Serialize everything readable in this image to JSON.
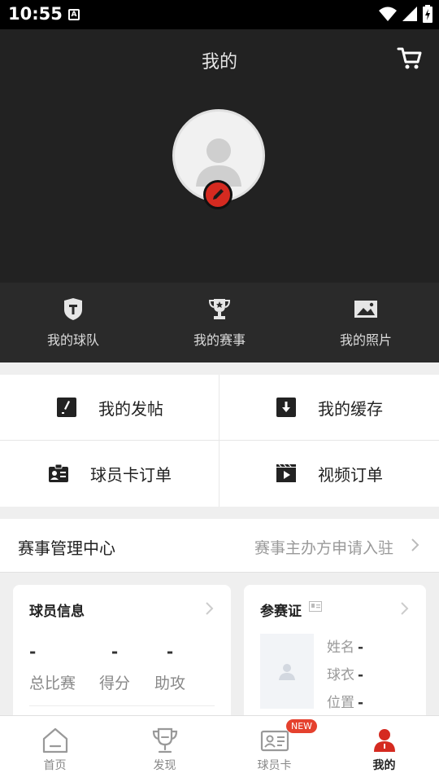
{
  "status": {
    "time": "10:55",
    "a_icon": "A"
  },
  "header": {
    "title": "我的"
  },
  "quicknav": [
    {
      "label": "我的球队",
      "icon": "team-shield-icon"
    },
    {
      "label": "我的赛事",
      "icon": "trophy-icon"
    },
    {
      "label": "我的照片",
      "icon": "photo-icon"
    }
  ],
  "grid": {
    "posts": "我的发帖",
    "cache": "我的缓存",
    "card_orders": "球员卡订单",
    "video_orders": "视频订单"
  },
  "management": {
    "title": "赛事管理中心",
    "link": "赛事主办方申请入驻"
  },
  "player_info": {
    "title": "球员信息",
    "stats": [
      {
        "value": "-",
        "label": "总比赛"
      },
      {
        "value": "-",
        "label": "得分"
      },
      {
        "value": "-",
        "label": "助攻"
      }
    ]
  },
  "credential": {
    "title": "参赛证",
    "name_label": "姓名",
    "name_value": "-",
    "jersey_label": "球衣",
    "jersey_value": "-",
    "position_label": "位置",
    "position_value": "-"
  },
  "tabbar": [
    {
      "label": "首页",
      "icon": "home-icon"
    },
    {
      "label": "发现",
      "icon": "trophy-icon"
    },
    {
      "label": "球员卡",
      "icon": "id-card-icon",
      "badge": "NEW"
    },
    {
      "label": "我的",
      "icon": "person-icon",
      "active": true
    }
  ],
  "colors": {
    "accent": "#d52a20",
    "header_bg": "#222222",
    "badge": "#e5412e"
  }
}
